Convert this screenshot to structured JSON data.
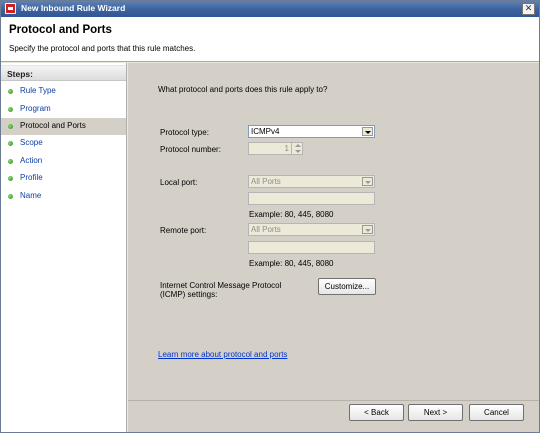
{
  "window": {
    "title": "New Inbound Rule Wizard",
    "close_glyph": "✕"
  },
  "header": {
    "title": "Protocol and Ports",
    "description": "Specify the protocol and ports that this rule matches."
  },
  "steps": {
    "heading": "Steps:",
    "items": [
      {
        "label": "Rule Type"
      },
      {
        "label": "Program"
      },
      {
        "label": "Protocol and Ports",
        "active": true
      },
      {
        "label": "Scope"
      },
      {
        "label": "Action"
      },
      {
        "label": "Profile"
      },
      {
        "label": "Name"
      }
    ]
  },
  "main": {
    "question": "What protocol and ports does this rule apply to?",
    "protocol_type": {
      "label": "Protocol type:",
      "value": "ICMPv4"
    },
    "protocol_number": {
      "label": "Protocol number:",
      "value": "1"
    },
    "local_port": {
      "label": "Local port:",
      "value": "All Ports",
      "text": "",
      "example": "Example: 80, 445, 8080"
    },
    "remote_port": {
      "label": "Remote port:",
      "value": "All Ports",
      "text": "",
      "example": "Example: 80, 445, 8080"
    },
    "icmp": {
      "label_line1": "Internet Control Message Protocol",
      "label_line2": "(ICMP) settings:",
      "button": "Customize..."
    },
    "link": "Learn more about protocol and ports"
  },
  "buttons": {
    "back": "< Back",
    "next": "Next >",
    "cancel": "Cancel"
  }
}
